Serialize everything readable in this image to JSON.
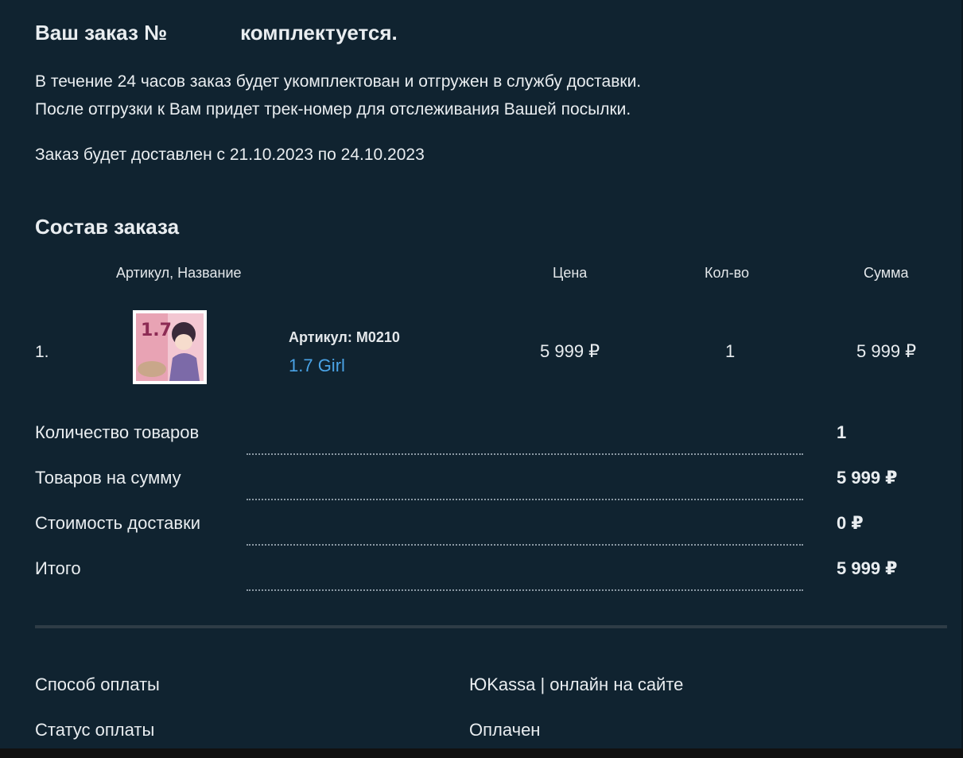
{
  "header": {
    "title_prefix": "Ваш заказ №",
    "title_suffix": "комплектуется."
  },
  "info": {
    "line1": "В течение 24 часов заказ будет укомплектован и отгружен в службу доставки.",
    "line2": "После отгрузки к Вам придет трек-номер для отслеживания Вашей посылки.",
    "delivery": "Заказ будет доставлен с 21.10.2023 по 24.10.2023"
  },
  "order": {
    "section_title": "Состав заказа",
    "columns": {
      "name": "Артикул, Название",
      "price": "Цена",
      "qty": "Кол-во",
      "sum": "Сумма"
    },
    "items": [
      {
        "index": "1.",
        "article": "Артикул: M0210",
        "name": "1.7 Girl",
        "price": "5 999 ₽",
        "qty": "1",
        "sum": "5 999 ₽",
        "thumb_colors": [
          "#f3c7d2",
          "#e8a3b4",
          "#c9a78a",
          "#7c6aa8"
        ]
      }
    ]
  },
  "summary": [
    {
      "label": "Количество товаров",
      "value": "1"
    },
    {
      "label": "Товаров на сумму",
      "value": "5 999 ₽"
    },
    {
      "label": "Стоимость доставки",
      "value": "0 ₽"
    },
    {
      "label": "Итого",
      "value": "5 999 ₽"
    }
  ],
  "payment": {
    "method_label": "Способ оплаты",
    "method_value": "ЮKassa | онлайн на сайте",
    "status_label": "Статус оплаты",
    "status_value": "Оплачен"
  },
  "colors": {
    "background": "#102330",
    "text": "#e9edf0",
    "link": "#4aa3e6",
    "divider": "#2e3c46"
  }
}
